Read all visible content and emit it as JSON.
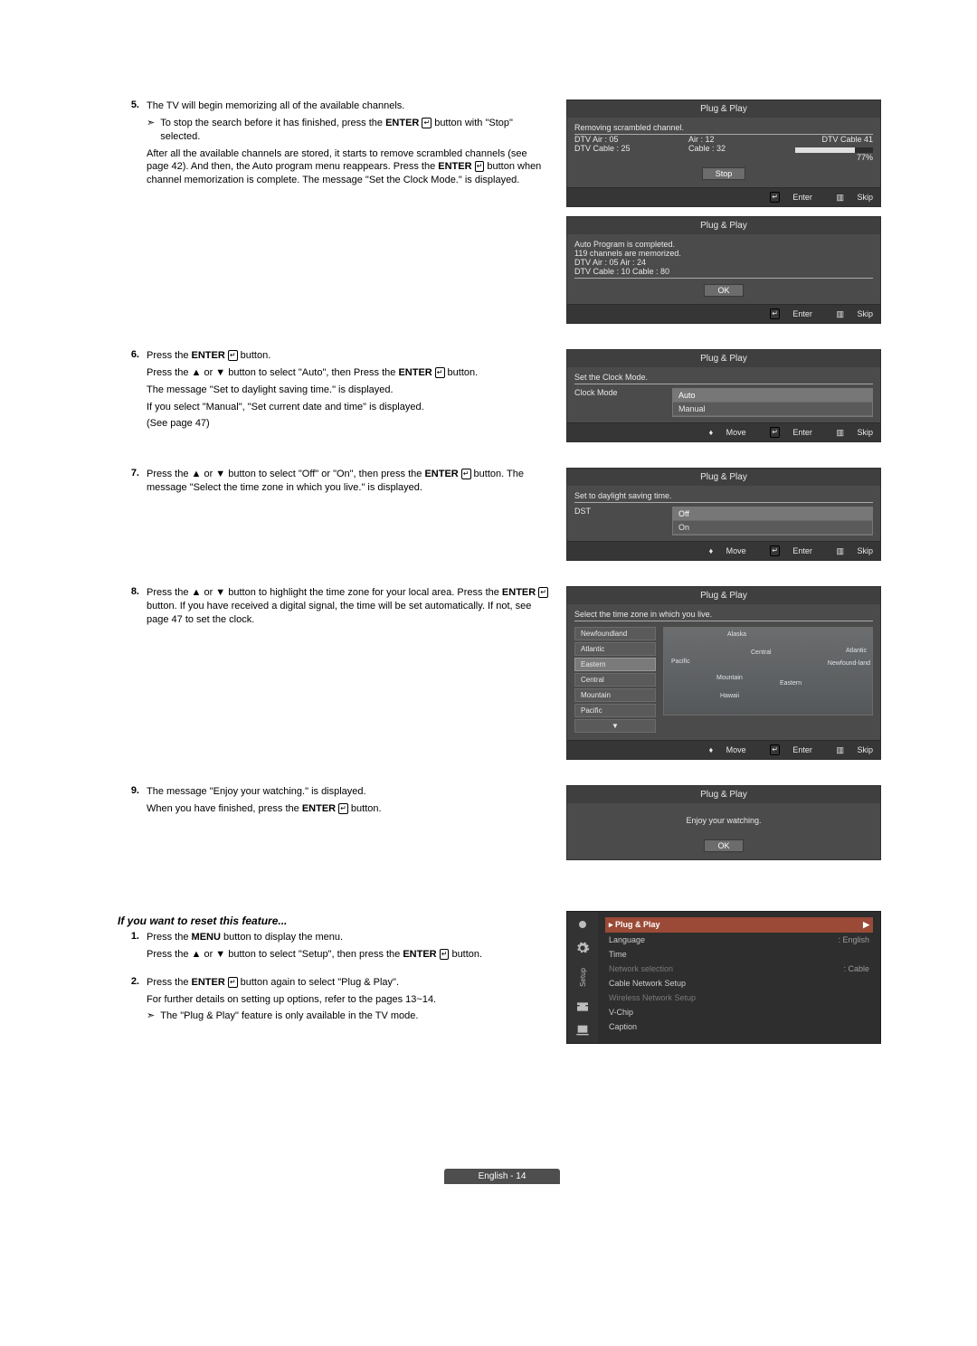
{
  "steps": {
    "s5": {
      "num": "5.",
      "p1": "The TV will begin memorizing all of the available channels.",
      "note": "To stop the search before it has finished, press the ",
      "note_b": "ENTER",
      "note_tail": " button with \"Stop\" selected.",
      "p2a": "After all the available channels are stored, it starts to remove scrambled channels (see page 42). And then, the Auto program menu reappears. Press the ",
      "p2b": "ENTER",
      "p2c": " button when channel memorization is complete. The message \"Set the Clock Mode.\" is displayed."
    },
    "s6": {
      "num": "6.",
      "l1a": "Press the ",
      "l1b": "ENTER",
      "l1c": " button.",
      "l2a": "Press the ▲ or ▼ button to select \"Auto\", then Press the ",
      "l2b": "ENTER",
      "l2c": " button.",
      "l3": "The message \"Set to daylight saving time.\" is displayed.",
      "l4": "If you select \"Manual\", \"Set current date and time\" is displayed.",
      "l5": "(See page 47)"
    },
    "s7": {
      "num": "7.",
      "t1a": "Press the ▲ or ▼ button to select \"Off\" or \"On\", then press the ",
      "t1b": "ENTER",
      "t1c": " button. The message \"Select the time zone in which you live.\" is displayed."
    },
    "s8": {
      "num": "8.",
      "t1a": "Press the ▲ or ▼ button to highlight the time zone for your local area. Press the ",
      "t1b": "ENTER",
      "t1c": " button. If you have received a digital signal, the time will be set automatically. If not, see page 47 to set the clock."
    },
    "s9": {
      "num": "9.",
      "l1": "The message \"Enjoy your watching.\" is displayed.",
      "l2a": "When you have finished, press the ",
      "l2b": "ENTER",
      "l2c": " button."
    }
  },
  "reset": {
    "heading": "If you want to reset this feature...",
    "i1": {
      "num": "1.",
      "a": "Press the ",
      "b": "MENU",
      "c": " button to display the menu.",
      "d": "Press the ▲ or ▼ button to select \"Setup\", then press the ",
      "e": "ENTER",
      "f": " button."
    },
    "i2": {
      "num": "2.",
      "a": "Press the ",
      "b": "ENTER",
      "c": " button again to select \"Plug & Play\".",
      "d": "For further details on setting up options, refer to the pages 13~14.",
      "note": "The \"Plug & Play\" feature is only available in the TV mode."
    }
  },
  "osd1": {
    "title": "Plug & Play",
    "status": "Removing scrambled channel.",
    "r1a": "DTV Air : 05",
    "r1b": "Air : 12",
    "r2a": "DTV Cable : 25",
    "r2b": "Cable : 32",
    "r_right": "DTV Cable 41",
    "pct": "77%",
    "btn": "Stop",
    "foot_enter": "Enter",
    "foot_skip": "Skip"
  },
  "osd2": {
    "title": "Plug & Play",
    "l1": "Auto Program is completed.",
    "l2": "119 channels are memorized.",
    "l3": "DTV Air : 05    Air : 24",
    "l4": "DTV Cable : 10    Cable : 80",
    "btn": "OK",
    "foot_enter": "Enter",
    "foot_skip": "Skip"
  },
  "osd3": {
    "title": "Plug & Play",
    "prompt": "Set the Clock Mode.",
    "label": "Clock Mode",
    "opt1": "Auto",
    "opt2": "Manual",
    "foot_move": "Move",
    "foot_enter": "Enter",
    "foot_skip": "Skip"
  },
  "osd4": {
    "title": "Plug & Play",
    "prompt": "Set to daylight saving time.",
    "label": "DST",
    "opt1": "Off",
    "opt2": "On",
    "foot_move": "Move",
    "foot_enter": "Enter",
    "foot_skip": "Skip"
  },
  "osd5": {
    "title": "Plug & Play",
    "prompt": "Select the time zone in which you live.",
    "tz": [
      "Newfoundland",
      "Atlantic",
      "Eastern",
      "Central",
      "Mountain",
      "Pacific"
    ],
    "map_labels": [
      "Alaska",
      "Pacific",
      "Mountain",
      "Hawaii",
      "Central",
      "Eastern",
      "Atlantic",
      "Newfound-land"
    ],
    "foot_move": "Move",
    "foot_enter": "Enter",
    "foot_skip": "Skip"
  },
  "osd6": {
    "title": "Plug & Play",
    "msg": "Enjoy your watching.",
    "btn": "OK"
  },
  "setup": {
    "tab": "Setup",
    "items": [
      {
        "k": "Plug & Play",
        "v": "",
        "hl": true
      },
      {
        "k": "Language",
        "v": ": English"
      },
      {
        "k": "Time",
        "v": ""
      },
      {
        "k": "Network selection",
        "v": ": Cable",
        "dim": true
      },
      {
        "k": "Cable Network Setup",
        "v": ""
      },
      {
        "k": "Wireless Network Setup",
        "v": "",
        "dim": true
      },
      {
        "k": "V-Chip",
        "v": ""
      },
      {
        "k": "Caption",
        "v": ""
      }
    ]
  },
  "glyphs": {
    "enter": "↵",
    "arrow": "➣",
    "updown": "♦",
    "rtn_icon": "⎆",
    "menu_icon": "▥"
  },
  "page_footer": "English - 14"
}
